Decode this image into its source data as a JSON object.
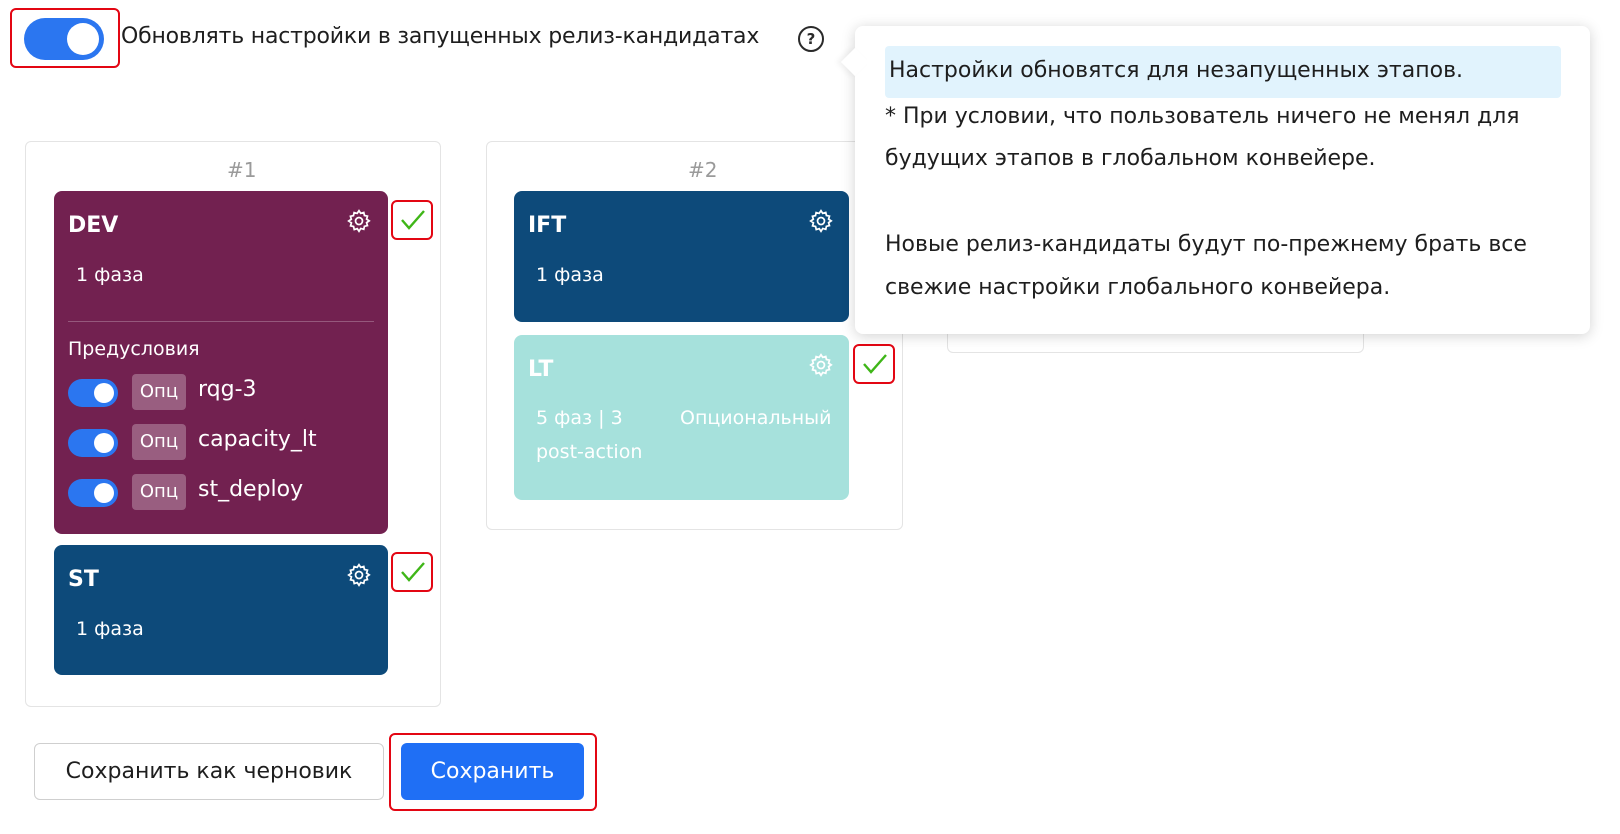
{
  "top": {
    "update_toggle_label": "Обновлять настройки в запущенных релиз-кандидатах",
    "help_icon": "question-circle-icon",
    "toggle_on": true
  },
  "columns": [
    {
      "number": "#1",
      "stages": [
        {
          "title": "DEV",
          "phase": "1 фаза",
          "color": "#722150",
          "preconditions_title": "Предусловия",
          "preconditions": [
            {
              "tag": "Опц",
              "name": "rqg-3",
              "enabled": true
            },
            {
              "tag": "Опц",
              "name": "capacity_lt",
              "enabled": true
            },
            {
              "tag": "Опц",
              "name": "st_deploy",
              "enabled": true
            }
          ]
        },
        {
          "title": "ST",
          "phase": "1 фаза",
          "color": "#0d4a7a"
        }
      ]
    },
    {
      "number": "#2",
      "stages": [
        {
          "title": "IFT",
          "phase": "1 фаза",
          "color": "#0d4a7a"
        },
        {
          "title": "LT",
          "phase": "5 фаз | 3",
          "phase_line2": "post-action",
          "optional": "Опциональный",
          "color": "#a6e1dc"
        }
      ]
    }
  ],
  "tooltip": {
    "highlight": "Настройки обновятся для незапущенных этапов.",
    "line1": "* При условии, что пользователь ничего не менял для",
    "line2": "будущих этапов в глобальном конвейере.",
    "line3": "Новые релиз-кандидаты будут по-прежнему брать все",
    "line4": "свежие настройки глобального конвейера."
  },
  "buttons": {
    "draft": "Сохранить как черновик",
    "save": "Сохранить"
  },
  "colors": {
    "accent": "#2b76f0",
    "check": "#3fb618",
    "highlight_border": "#e30613"
  }
}
